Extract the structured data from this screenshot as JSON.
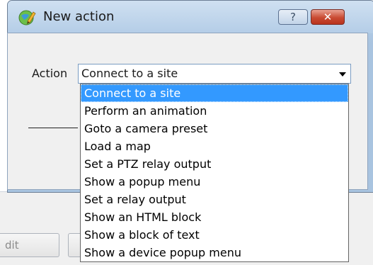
{
  "dialog": {
    "title": "New action",
    "help_label": "?",
    "close_label": "✕"
  },
  "form": {
    "action_label": "Action",
    "selected_value": "Connect to a site"
  },
  "dropdown": {
    "options": [
      "Connect to a site",
      "Perform an animation",
      "Goto a camera preset",
      "Load a map",
      "Set a PTZ relay output",
      "Show a popup menu",
      "Set a relay output",
      "Show an HTML block",
      "Show a block of text",
      "Show a device popup menu"
    ],
    "selected_index": 0,
    "highlight_color": "#3399ff"
  },
  "parent_window": {
    "edit_button_label": "dit"
  },
  "icons": {
    "app": "pencil-globe-icon",
    "combo_arrow": "chevron-down-icon"
  }
}
